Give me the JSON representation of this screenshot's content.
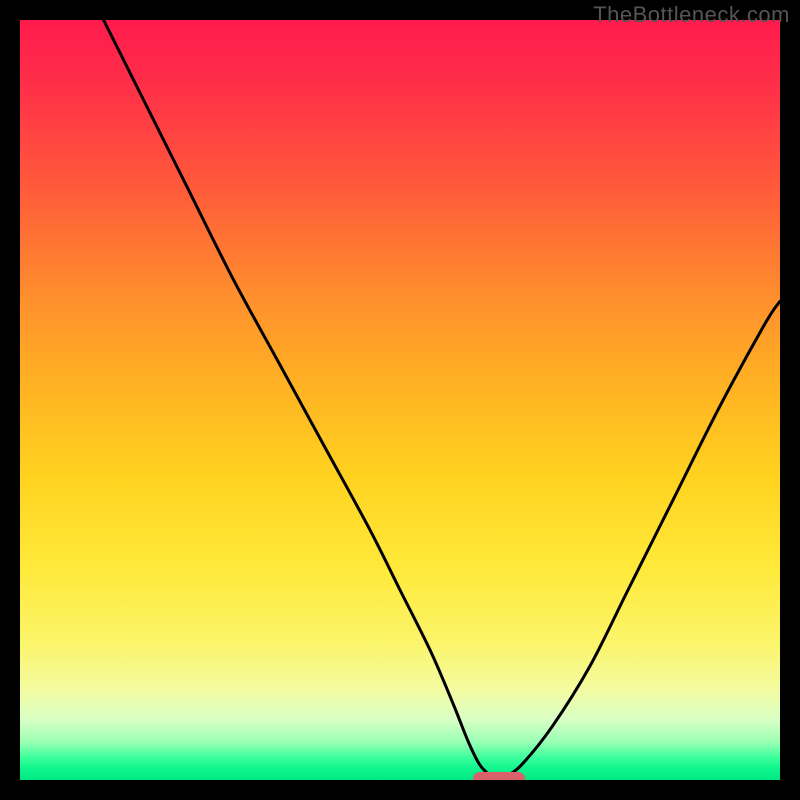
{
  "watermark": "TheBottleneck.com",
  "chart_data": {
    "type": "line",
    "title": "",
    "xlabel": "",
    "ylabel": "",
    "xlim": [
      0,
      100
    ],
    "ylim": [
      0,
      100
    ],
    "grid": false,
    "series": [
      {
        "name": "bottleneck-curve",
        "x": [
          11,
          16,
          22,
          28,
          34,
          40,
          46,
          50,
          54,
          57,
          59,
          60.5,
          62,
          63,
          64,
          66,
          70,
          75,
          80,
          86,
          92,
          98,
          100
        ],
        "y": [
          100,
          90,
          78,
          66,
          55,
          44,
          33,
          25,
          17,
          10,
          5,
          2,
          0.5,
          0,
          0.5,
          2,
          7,
          15,
          25,
          37,
          49,
          60,
          63
        ]
      }
    ],
    "minimum_marker": {
      "x": 63,
      "y": 0
    },
    "background_gradient": {
      "top": "#ff1a4d",
      "mid": "#ffe93a",
      "bottom": "#00e884"
    }
  }
}
